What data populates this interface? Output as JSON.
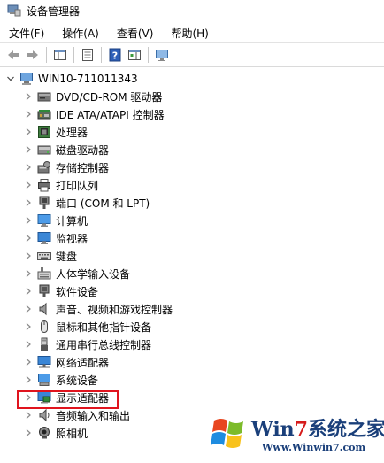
{
  "window": {
    "title": "设备管理器",
    "icon": "device-manager-icon"
  },
  "menu": [
    "文件(F)",
    "操作(A)",
    "查看(V)",
    "帮助(H)"
  ],
  "toolbar": {
    "buttons": [
      "back-arrow-icon",
      "forward-arrow-icon",
      "console-tree-icon",
      "properties-icon",
      "help-icon",
      "action-pane-icon",
      "monitor-icon"
    ]
  },
  "tree": {
    "root": {
      "label": "WIN10-711011343",
      "expanded": true,
      "icon": "computer-icon"
    },
    "items": [
      {
        "label": "DVD/CD-ROM 驱动器",
        "icon": "dvd-drive-icon"
      },
      {
        "label": "IDE ATA/ATAPI 控制器",
        "icon": "ide-controller-icon"
      },
      {
        "label": "处理器",
        "icon": "processor-icon"
      },
      {
        "label": "磁盘驱动器",
        "icon": "disk-drive-icon"
      },
      {
        "label": "存储控制器",
        "icon": "storage-controller-icon"
      },
      {
        "label": "打印队列",
        "icon": "printer-icon"
      },
      {
        "label": "端口 (COM 和 LPT)",
        "icon": "port-icon"
      },
      {
        "label": "计算机",
        "icon": "computer-monitor-icon"
      },
      {
        "label": "监视器",
        "icon": "monitor-icon"
      },
      {
        "label": "键盘",
        "icon": "keyboard-icon"
      },
      {
        "label": "人体学输入设备",
        "icon": "hid-icon"
      },
      {
        "label": "软件设备",
        "icon": "software-device-icon"
      },
      {
        "label": "声音、视频和游戏控制器",
        "icon": "speaker-icon"
      },
      {
        "label": "鼠标和其他指针设备",
        "icon": "mouse-icon"
      },
      {
        "label": "通用串行总线控制器",
        "icon": "usb-icon"
      },
      {
        "label": "网络适配器",
        "icon": "network-adapter-icon"
      },
      {
        "label": "系统设备",
        "icon": "system-device-icon"
      },
      {
        "label": "显示适配器",
        "icon": "display-adapter-icon",
        "highlighted": true
      },
      {
        "label": "音频输入和输出",
        "icon": "audio-icon"
      },
      {
        "label": "照相机",
        "icon": "camera-icon"
      }
    ]
  },
  "watermark": {
    "main": "Win7系统之家",
    "sub": "Www.Winwin7.com"
  },
  "colors": {
    "highlight_border": "#e0141e",
    "arrow": "#8a8a8a",
    "watermark_blue": "#1a3f7a",
    "watermark_red": "#d61b1b"
  }
}
